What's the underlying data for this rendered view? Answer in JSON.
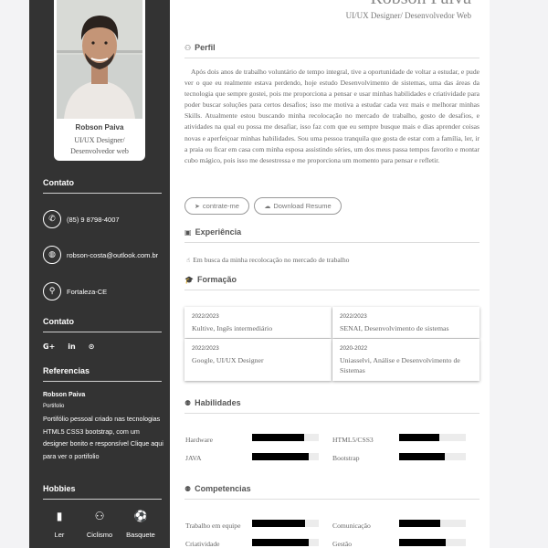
{
  "profile": {
    "name": "Robson Paiva",
    "role": "UI/UX Designer/ Desenvolvedor web"
  },
  "header": {
    "name": "Robson Paiva",
    "role": "UI/UX Designer/ Desenvolvedor Web"
  },
  "sidebar": {
    "contact_heading": "Contato",
    "contacts": [
      {
        "icon": "phone-icon",
        "text": "(85) 9 8798-4007"
      },
      {
        "icon": "globe-icon",
        "text": "robson-costa@outlook.com.br"
      },
      {
        "icon": "map-pin-icon",
        "text": "Fortaleza-CE"
      }
    ],
    "social_heading": "Contato",
    "social_icons": {
      "google": "G+",
      "linkedin": "in",
      "github": "github-icon"
    },
    "references_heading": "Referencias",
    "reference": {
      "name": "Robson Paiva",
      "subtitle": "Portifolio",
      "description": "Portifólio pessoal criado nas tecnologias HTML5 CSS3 bootstrap, com um designer bonito e responsível Clique aqui para ver o portifolio"
    },
    "hobbies_heading": "Hobbies",
    "hobbies": [
      {
        "icon": "book-icon",
        "label": "Ler"
      },
      {
        "icon": "bicycle-icon",
        "label": "Ciclismo"
      },
      {
        "icon": "basketball-icon",
        "label": "Basquete"
      }
    ]
  },
  "main": {
    "profile_title": "Perfil",
    "about": "Após dois anos de trabalho voluntário de tempo integral, tive a oportunidade de voltar a estudar, e pude ver o que eu realmente estava perdendo, hoje estudo Desenvolvimento de sistemas, uma das áreas da tecnologia que sempre gostei, pois me proporciona a pensar e usar minhas habilidades e criatividade para poder buscar soluções para certos desafios; isso me motiva a estudar cada vez mais e melhorar minhas Skills. Atualmente estou buscando minha recolocação no mercado de trabalho, gosto de desafios, e atividades na qual eu possa me desafiar, isso faz com que eu sempre busque mais e dias aprender coisas novas e aperfeiçoar minhas habilidades. Sou uma pessoa tranquila que gosta de estar com a família, ler, ir a praia ou ficar em casa com minha esposa assistindo séries, um dos meus passa tempos favorito e montar cubo mágico, pois isso me desestressa e me proporciona um momento para pensar e refletir.",
    "contact_button": "contrate-me",
    "download_button": "Download Resume",
    "experience_title": "Experiência",
    "experience_item": "Em busca da minha recolocação no mercado de trabalho",
    "education_title": "Formação",
    "education": [
      {
        "period": "2022/2023",
        "name": "Kultive, Ingês intermediário"
      },
      {
        "period": "2022/2023",
        "name": "SENAI, Desenvolvimento de sistemas"
      },
      {
        "period": "2022/2023",
        "name": "Google, UI/UX Designer"
      },
      {
        "period": "2020-2022",
        "name": "Uniasselvi, Análise e Desenvolvimento de Sistemas"
      }
    ],
    "skills_title": "Habilidades",
    "skills": [
      {
        "label": "Hardware",
        "level": 0.78
      },
      {
        "label": "HTML5/CSS3",
        "level": 0.6
      },
      {
        "label": "JAVA",
        "level": 0.85
      },
      {
        "label": "Bootstrap",
        "level": 0.68
      }
    ],
    "competencies_title": "Competencias",
    "competencies": [
      {
        "label": "Trabalho em equipe",
        "level": 0.8
      },
      {
        "label": "Comunicação",
        "level": 0.62
      },
      {
        "label": "Criatividade",
        "level": 0.85
      },
      {
        "label": "Gestão",
        "level": 0.7
      }
    ]
  }
}
